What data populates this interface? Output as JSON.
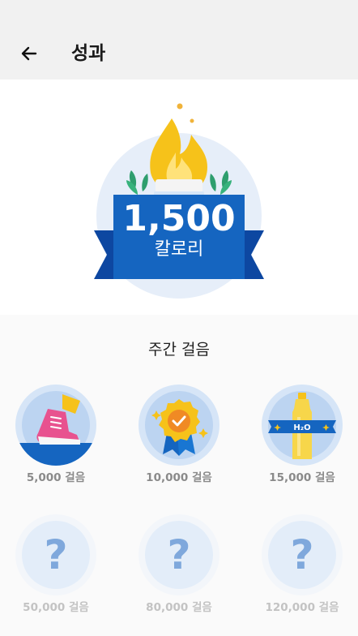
{
  "header": {
    "back_icon": "arrow-left-icon",
    "title": "성과"
  },
  "hero": {
    "value": "1,500",
    "unit": "칼로리",
    "icon": "flame-trophy-icon",
    "colors": {
      "ribbon": "#1565c0",
      "ribbon_dark": "#0d47a1",
      "circle": "#e6eef9",
      "flame": "#fbc02d"
    }
  },
  "weekly": {
    "title": "주간 걸음",
    "badges": [
      {
        "label": "5,000 걸음",
        "icon": "sneaker-icon",
        "unlocked": true
      },
      {
        "label": "10,000 걸음",
        "icon": "medal-check-icon",
        "unlocked": true
      },
      {
        "label": "15,000 걸음",
        "icon": "water-bottle-icon",
        "bottle_text": "H₂O",
        "unlocked": true
      },
      {
        "label": "50,000 걸음",
        "icon": "question-icon",
        "unlocked": false,
        "symbol": "?"
      },
      {
        "label": "80,000 걸음",
        "icon": "question-icon",
        "unlocked": false,
        "symbol": "?"
      },
      {
        "label": "120,000 걸음",
        "icon": "question-icon",
        "unlocked": false,
        "symbol": "?"
      }
    ]
  }
}
